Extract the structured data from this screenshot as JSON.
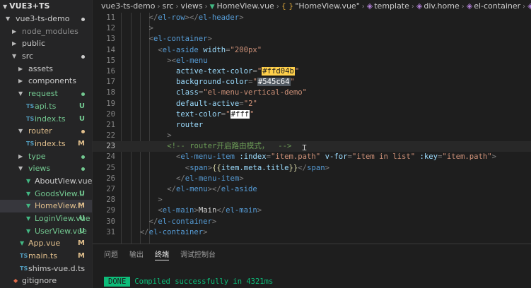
{
  "explorer": {
    "project_name": "VUE3+TS",
    "items": [
      {
        "label": "vue3-ts-demo",
        "kind": "folder",
        "open": true,
        "indent": 0,
        "status": "dot",
        "color": "#cccccc"
      },
      {
        "label": "node_modules",
        "kind": "folder",
        "open": false,
        "indent": 1,
        "status": "",
        "color": "#8c8c8c"
      },
      {
        "label": "public",
        "kind": "folder",
        "open": false,
        "indent": 1,
        "status": "",
        "color": "#cccccc"
      },
      {
        "label": "src",
        "kind": "folder",
        "open": true,
        "indent": 1,
        "status": "dot",
        "color": "#cccccc"
      },
      {
        "label": "assets",
        "kind": "folder",
        "open": false,
        "indent": 2,
        "status": "",
        "color": "#cccccc"
      },
      {
        "label": "components",
        "kind": "folder",
        "open": false,
        "indent": 2,
        "status": "",
        "color": "#cccccc"
      },
      {
        "label": "request",
        "kind": "folder",
        "open": true,
        "indent": 2,
        "status": "dot",
        "color": "#73c991"
      },
      {
        "label": "api.ts",
        "kind": "ts",
        "indent": 3,
        "status": "U",
        "color": "#73c991"
      },
      {
        "label": "index.ts",
        "kind": "ts",
        "indent": 3,
        "status": "U",
        "color": "#73c991"
      },
      {
        "label": "router",
        "kind": "folder",
        "open": true,
        "indent": 2,
        "status": "dot",
        "color": "#e2c08d"
      },
      {
        "label": "index.ts",
        "kind": "ts",
        "indent": 3,
        "status": "M",
        "color": "#e2c08d"
      },
      {
        "label": "type",
        "kind": "folder",
        "open": false,
        "indent": 2,
        "status": "dot",
        "color": "#73c991"
      },
      {
        "label": "views",
        "kind": "folder",
        "open": true,
        "indent": 2,
        "status": "dot",
        "color": "#73c991"
      },
      {
        "label": "AboutView.vue",
        "kind": "vue",
        "indent": 3,
        "status": "",
        "color": "#cccccc"
      },
      {
        "label": "GoodsView...",
        "kind": "vue",
        "indent": 3,
        "status": "U",
        "color": "#73c991"
      },
      {
        "label": "HomeView...",
        "kind": "vue",
        "indent": 3,
        "status": "M",
        "color": "#e2c08d",
        "selected": true
      },
      {
        "label": "LoginView.vue",
        "kind": "vue",
        "indent": 3,
        "status": "U",
        "color": "#73c991"
      },
      {
        "label": "UserView.vue",
        "kind": "vue",
        "indent": 3,
        "status": "U",
        "color": "#73c991"
      },
      {
        "label": "App.vue",
        "kind": "vue",
        "indent": 2,
        "status": "M",
        "color": "#e2c08d"
      },
      {
        "label": "main.ts",
        "kind": "ts",
        "indent": 2,
        "status": "M",
        "color": "#e2c08d"
      },
      {
        "label": "shims-vue.d.ts",
        "kind": "ts",
        "indent": 2,
        "status": "",
        "color": "#cccccc"
      },
      {
        "label": "gitignore",
        "kind": "git",
        "indent": 1,
        "status": "",
        "color": "#cccccc"
      }
    ]
  },
  "breadcrumb": {
    "parts": [
      "vue3-ts-demo",
      "src",
      "views",
      "HomeView.vue",
      "\"HomeView.vue\"",
      "template",
      "div.home",
      "el-container",
      "el-container"
    ],
    "braces_glyph": "{ }"
  },
  "editor": {
    "active_line": 23,
    "lines": [
      {
        "num": 11,
        "indent": 4,
        "tokens": [
          [
            "punc",
            "</"
          ],
          [
            "tag",
            "el-row"
          ],
          [
            "punc",
            "></"
          ],
          [
            "tag",
            "el-header"
          ],
          [
            "punc",
            ">"
          ]
        ]
      },
      {
        "num": 12,
        "indent": 4,
        "tokens": [
          [
            "punc",
            ">"
          ]
        ]
      },
      {
        "num": 13,
        "indent": 4,
        "tokens": [
          [
            "punc",
            "<"
          ],
          [
            "tag",
            "el-container"
          ],
          [
            "punc",
            ">"
          ]
        ]
      },
      {
        "num": 14,
        "indent": 6,
        "tokens": [
          [
            "punc",
            "<"
          ],
          [
            "tag",
            "el-aside"
          ],
          [
            "text",
            " "
          ],
          [
            "attr",
            "width"
          ],
          [
            "punc",
            "="
          ],
          [
            "str",
            "\"200px\""
          ]
        ]
      },
      {
        "num": 15,
        "indent": 8,
        "tokens": [
          [
            "punc",
            ">"
          ],
          [
            "punc",
            "<"
          ],
          [
            "tag",
            "el-menu"
          ]
        ]
      },
      {
        "num": 16,
        "indent": 10,
        "tokens": [
          [
            "attr",
            "active-text-color"
          ],
          [
            "punc",
            "="
          ],
          [
            "str",
            "\""
          ],
          [
            "sw-yellow",
            "#ffd04b"
          ],
          [
            "str",
            "\""
          ]
        ]
      },
      {
        "num": 17,
        "indent": 10,
        "tokens": [
          [
            "attr",
            "background-color"
          ],
          [
            "punc",
            "="
          ],
          [
            "str",
            "\""
          ],
          [
            "sw-slate",
            "#545c64"
          ],
          [
            "str",
            "\""
          ]
        ]
      },
      {
        "num": 18,
        "indent": 10,
        "tokens": [
          [
            "attr",
            "class"
          ],
          [
            "punc",
            "="
          ],
          [
            "str",
            "\"el-menu-vertical-demo\""
          ]
        ]
      },
      {
        "num": 19,
        "indent": 10,
        "tokens": [
          [
            "attr",
            "default-active"
          ],
          [
            "punc",
            "="
          ],
          [
            "str",
            "\"2\""
          ]
        ]
      },
      {
        "num": 20,
        "indent": 10,
        "tokens": [
          [
            "attr",
            "text-color"
          ],
          [
            "punc",
            "="
          ],
          [
            "str",
            "\""
          ],
          [
            "sw-white",
            "#fff"
          ],
          [
            "str",
            "\""
          ]
        ]
      },
      {
        "num": 21,
        "indent": 10,
        "tokens": [
          [
            "attr",
            "router"
          ]
        ]
      },
      {
        "num": 22,
        "indent": 8,
        "tokens": [
          [
            "punc",
            ">"
          ]
        ]
      },
      {
        "num": 23,
        "indent": 8,
        "tokens": [
          [
            "com",
            "<!-- router开启路由模式，  -->"
          ]
        ]
      },
      {
        "num": 24,
        "indent": 10,
        "tokens": [
          [
            "punc",
            "<"
          ],
          [
            "tag",
            "el-menu-item"
          ],
          [
            "text",
            " "
          ],
          [
            "attr",
            ":index"
          ],
          [
            "punc",
            "="
          ],
          [
            "str",
            "\"item.path\""
          ],
          [
            "text",
            " "
          ],
          [
            "attr",
            "v-for"
          ],
          [
            "punc",
            "="
          ],
          [
            "str",
            "\"item in list\""
          ],
          [
            "text",
            " "
          ],
          [
            "attr",
            ":key"
          ],
          [
            "punc",
            "="
          ],
          [
            "str",
            "\"item.path\""
          ],
          [
            "punc",
            ">"
          ]
        ]
      },
      {
        "num": 25,
        "indent": 12,
        "tokens": [
          [
            "punc",
            "<"
          ],
          [
            "tag",
            "span"
          ],
          [
            "punc",
            ">"
          ],
          [
            "brace",
            "{{"
          ],
          [
            "var",
            "item.meta.title"
          ],
          [
            "brace",
            "}}"
          ],
          [
            "punc",
            "</"
          ],
          [
            "tag",
            "span"
          ],
          [
            "punc",
            ">"
          ]
        ]
      },
      {
        "num": 26,
        "indent": 10,
        "tokens": [
          [
            "punc",
            "</"
          ],
          [
            "tag",
            "el-menu-item"
          ],
          [
            "punc",
            ">"
          ]
        ]
      },
      {
        "num": 27,
        "indent": 8,
        "tokens": [
          [
            "punc",
            "</"
          ],
          [
            "tag",
            "el-menu"
          ],
          [
            "punc",
            "></"
          ],
          [
            "tag",
            "el-aside"
          ]
        ]
      },
      {
        "num": 28,
        "indent": 6,
        "tokens": [
          [
            "punc",
            ">"
          ]
        ]
      },
      {
        "num": 29,
        "indent": 6,
        "tokens": [
          [
            "punc",
            "<"
          ],
          [
            "tag",
            "el-main"
          ],
          [
            "punc",
            ">"
          ],
          [
            "text",
            "Main"
          ],
          [
            "punc",
            "</"
          ],
          [
            "tag",
            "el-main"
          ],
          [
            "punc",
            ">"
          ]
        ]
      },
      {
        "num": 30,
        "indent": 4,
        "tokens": [
          [
            "punc",
            "</"
          ],
          [
            "tag",
            "el-container"
          ],
          [
            "punc",
            ">"
          ]
        ]
      },
      {
        "num": 31,
        "indent": 2,
        "tokens": [
          [
            "punc",
            "</"
          ],
          [
            "tag",
            "el-container"
          ],
          [
            "punc",
            ">"
          ]
        ]
      }
    ]
  },
  "panel": {
    "tabs": [
      {
        "label": "问题",
        "active": false
      },
      {
        "label": "输出",
        "active": false
      },
      {
        "label": "终端",
        "active": true
      },
      {
        "label": "调试控制台",
        "active": false
      }
    ],
    "terminal": {
      "badge": "DONE",
      "message": "Compiled successfully in 4321ms"
    }
  },
  "colors": {
    "sidebar_bg": "#252526",
    "editor_bg": "#1e1e1e",
    "untracked": "#73c991",
    "modified": "#e2c08d",
    "vue_icon": "#42b883",
    "ts_icon": "#519aba",
    "terminal_success": "#0dbc79"
  }
}
